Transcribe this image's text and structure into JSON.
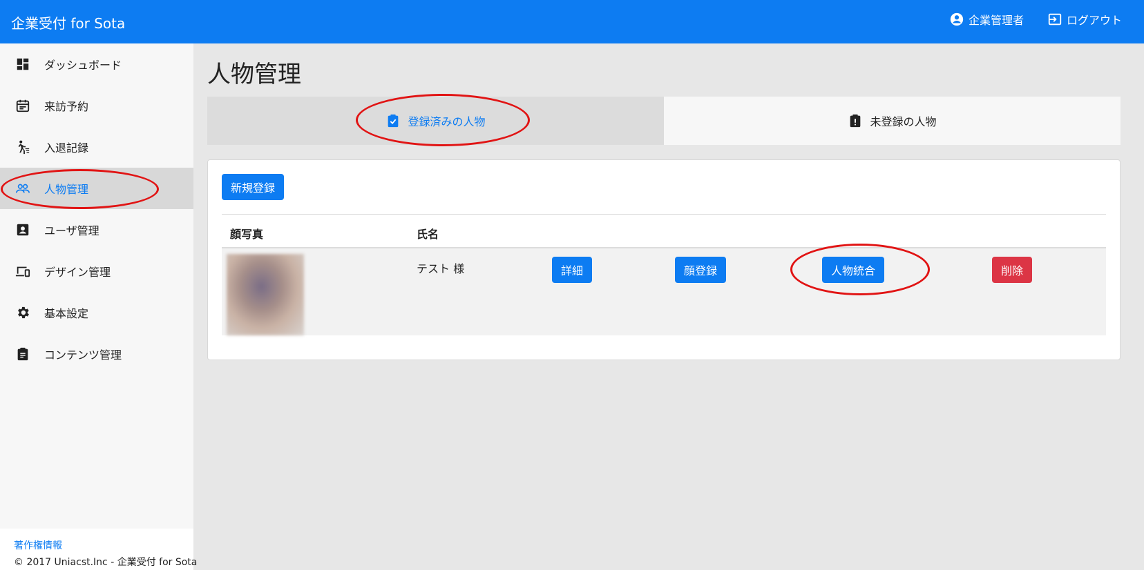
{
  "header": {
    "brand": "企業受付 for Sota",
    "user_label": "企業管理者",
    "logout_label": "ログアウト",
    "background": "#0d7cf2"
  },
  "sidebar": {
    "items": [
      {
        "label": "ダッシュボード",
        "icon": "dashboard-icon"
      },
      {
        "label": "来訪予約",
        "icon": "calendar-icon"
      },
      {
        "label": "入退記録",
        "icon": "walk-icon"
      },
      {
        "label": "人物管理",
        "icon": "people-icon",
        "active": true
      },
      {
        "label": "ユーザ管理",
        "icon": "account-box-icon"
      },
      {
        "label": "デザイン管理",
        "icon": "devices-icon"
      },
      {
        "label": "基本設定",
        "icon": "gear-icon"
      },
      {
        "label": "コンテンツ管理",
        "icon": "clipboard-icon"
      }
    ],
    "footer": {
      "link": "著作権情報",
      "copyright": "© 2017 Uniacst.Inc - 企業受付 for Sota"
    }
  },
  "main": {
    "title": "人物管理",
    "tabs": [
      {
        "label": "登録済みの人物",
        "icon": "clipboard-check-icon",
        "active": true
      },
      {
        "label": "未登録の人物",
        "icon": "clipboard-alert-icon",
        "active": false
      }
    ],
    "new_button": "新規登録",
    "table": {
      "headers": [
        "顔写真",
        "氏名"
      ],
      "rows": [
        {
          "name": "テスト 様",
          "actions": [
            "詳細",
            "顔登録",
            "人物統合",
            "削除"
          ]
        }
      ]
    }
  },
  "colors": {
    "accent": "#0d7cf2",
    "danger": "#dc3545",
    "annotation": "#e11414"
  }
}
